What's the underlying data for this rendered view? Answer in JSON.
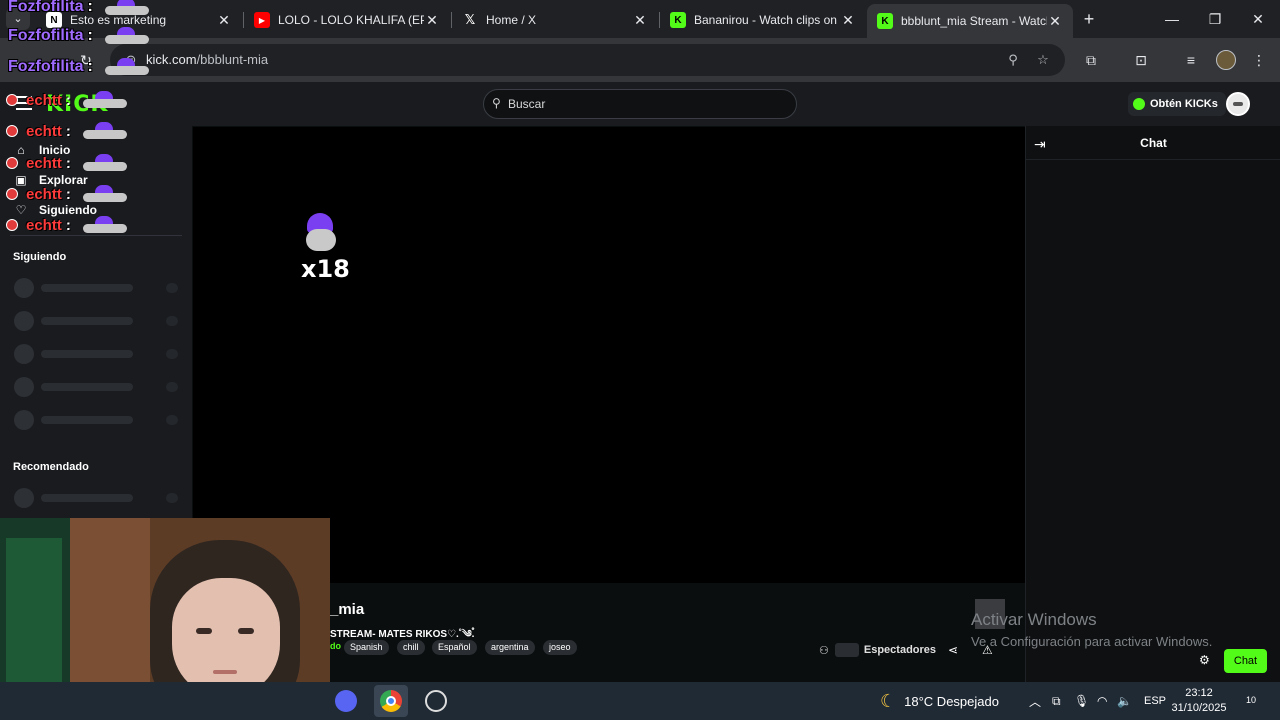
{
  "browser": {
    "tabs": [
      {
        "title": "Esto es marketing",
        "favicon": "notion-icon",
        "favicon_text": "N",
        "active": false
      },
      {
        "title": "LOLO - LOLO KHALIFA (EP) -",
        "favicon": "youtube-icon",
        "favicon_text": "▶",
        "active": false
      },
      {
        "title": "Home / X",
        "favicon": "x-icon",
        "favicon_text": "𝕏",
        "active": false
      },
      {
        "title": "Bananirou - Watch clips on",
        "favicon": "kick-icon",
        "favicon_text": "K",
        "active": false
      },
      {
        "title": "bbblunt_mia Stream - Watch",
        "favicon": "kick-icon",
        "favicon_text": "K",
        "active": true
      }
    ],
    "url_host": "kick.com",
    "url_path": "/bbblunt-mia"
  },
  "kick": {
    "logo": "KICK",
    "search_placeholder": "Buscar",
    "get_kicks": "Obtén KICKs",
    "nav": [
      {
        "label": "Inicio",
        "icon": "home-icon",
        "glyph": "⌂"
      },
      {
        "label": "Explorar",
        "icon": "explore-icon",
        "glyph": "▣"
      },
      {
        "label": "Siguiendo",
        "icon": "heart-icon",
        "glyph": "♡"
      }
    ],
    "following_heading": "Siguiendo",
    "recommended_heading": "Recomendado",
    "chat_title": "Chat",
    "chat_button": "Chat",
    "stream": {
      "name": "_mia",
      "title": "STREAM- MATES RIKOS♡.˚༄ཾ.",
      "category_fragment": "do",
      "tags": [
        "Spanish",
        "chill",
        "Español",
        "argentina",
        "joseo"
      ],
      "viewers_label": "Espectadores"
    },
    "player_overlay_multiplier": "x18"
  },
  "overlay_chat": [
    {
      "user": "Fozfofilita",
      "colon": ":",
      "style": "fozfo"
    },
    {
      "user": "Fozfofilita",
      "colon": ":",
      "style": "fozfo"
    },
    {
      "user": "Fozfofilita",
      "colon": ":",
      "style": "fozfo"
    },
    {
      "user": "echtt",
      "colon": ":",
      "style": "echtt"
    },
    {
      "user": "echtt",
      "colon": ":",
      "style": "echtt"
    },
    {
      "user": "echtt",
      "colon": ":",
      "style": "echtt"
    },
    {
      "user": "echtt",
      "colon": ":",
      "style": "echtt"
    },
    {
      "user": "echtt",
      "colon": ":",
      "style": "echtt"
    }
  ],
  "windows": {
    "activate_title": "Activar Windows",
    "activate_sub": "Ve a Configuración para activar Windows.",
    "weather": "18°C  Despejado",
    "lang": "ESP",
    "time": "23:12",
    "date": "31/10/2025",
    "notifications": "10"
  },
  "colors": {
    "kick_green": "#53fc18",
    "taskbar": "#202a35"
  }
}
